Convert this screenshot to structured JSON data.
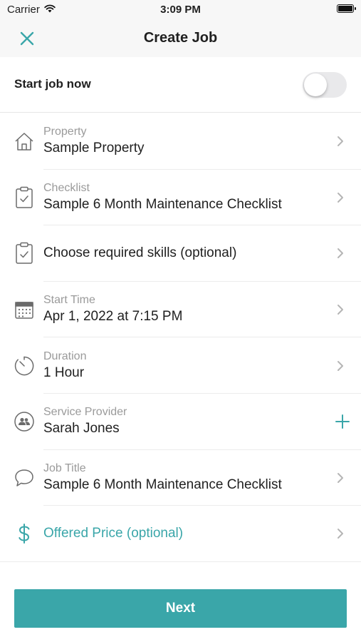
{
  "status_bar": {
    "carrier": "Carrier",
    "time": "3:09 PM",
    "battery": 1.0
  },
  "nav": {
    "title": "Create Job",
    "close_icon": "close-icon"
  },
  "start_job": {
    "label": "Start job now",
    "enabled": false
  },
  "rows": [
    {
      "icon": "house-icon",
      "label": "Property",
      "value": "Sample Property",
      "action": "chevron"
    },
    {
      "icon": "clipboard-check-icon",
      "label": "Checklist",
      "value": "Sample 6 Month Maintenance Checklist",
      "action": "chevron"
    },
    {
      "icon": "clipboard-check-icon",
      "label": "",
      "value": "Choose required skills (optional)",
      "action": "chevron"
    },
    {
      "icon": "calendar-icon",
      "label": "Start Time",
      "value": "Apr 1, 2022 at 7:15 PM",
      "action": "chevron"
    },
    {
      "icon": "timer-icon",
      "label": "Duration",
      "value": "1 Hour",
      "action": "chevron"
    },
    {
      "icon": "people-icon",
      "label": "Service Provider",
      "value": "Sarah Jones",
      "action": "plus"
    },
    {
      "icon": "chat-bubble-icon",
      "label": "Job Title",
      "value": "Sample 6 Month Maintenance Checklist",
      "action": "chevron"
    },
    {
      "icon": "dollar-icon",
      "label": "",
      "value": "Offered Price (optional)",
      "action": "chevron"
    }
  ],
  "next_button": {
    "label": "Next"
  },
  "colors": {
    "accent": "#3aa6a9",
    "label_gray": "#9a9a9a",
    "icon_gray": "#6b6b6b"
  }
}
